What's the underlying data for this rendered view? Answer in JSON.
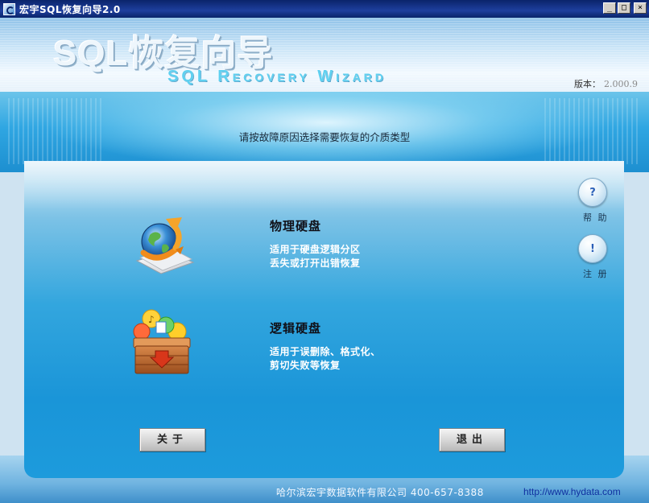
{
  "window": {
    "title": "宏宇SQL恢复向导2.0",
    "minimize_label": "_",
    "maximize_label": "□",
    "close_label": "×"
  },
  "header": {
    "logo_cn": "SQL恢复向导",
    "logo_en": "SQL Recovery Wizard",
    "version_label": "版本：",
    "version_number": "2.000.9"
  },
  "instruction": "请按故障原因选择需要恢复的介质类型",
  "options": [
    {
      "title": "物理硬盘",
      "desc_line1": "适用于硬盘逻辑分区",
      "desc_line2": "丢失或打开出错恢复",
      "icon": "globe-recycle-icon"
    },
    {
      "title": "逻辑硬盘",
      "desc_line1": "适用于误删除、格式化、",
      "desc_line2": "剪切失败等恢复",
      "icon": "crate-icon"
    }
  ],
  "side": {
    "help_label": "帮 助",
    "register_label": "注 册",
    "help_glyph": "?",
    "register_glyph": "!"
  },
  "buttons": {
    "about": "关于",
    "exit": "退出"
  },
  "footer": {
    "company": "哈尔滨宏宇数据软件有限公司  400-657-8388",
    "url": "http://www.hydata.com"
  },
  "colors": {
    "titlebar": "#0a246a",
    "panel_blue": "#1a95d8",
    "accent_cyan": "#5fd0f0"
  }
}
